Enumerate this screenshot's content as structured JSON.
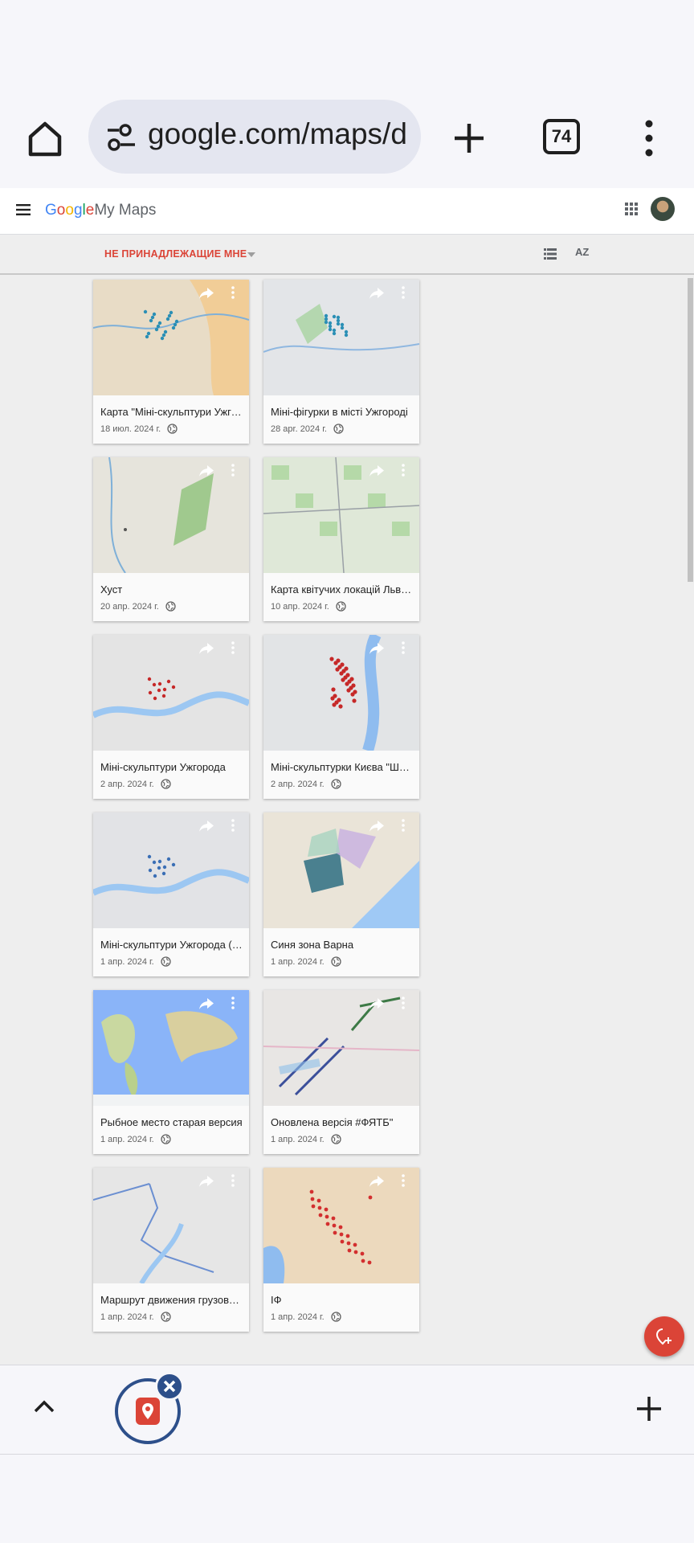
{
  "browser": {
    "url": "google.com/maps/d",
    "tab_count": "74",
    "icons": [
      "home-icon",
      "tune-icon",
      "new-tab-icon",
      "more-vert-icon"
    ]
  },
  "app": {
    "logo_google": "Google",
    "logo_product": "My Maps",
    "logo_colors": [
      "#4285f4",
      "#db4437",
      "#f4b400",
      "#4285f4",
      "#0f9d58",
      "#db4437"
    ]
  },
  "filter": {
    "label": "НЕ ПРИНАДЛЕЖАЩИЕ МНЕ",
    "sort_label": "AZ"
  },
  "maps": [
    {
      "title": "Карта \"Міні-скульптури Ужгорода\"",
      "date": "18 июл. 2024 г.",
      "theme": "orange-city"
    },
    {
      "title": "Міні-фігурки в місті Ужгороді",
      "date": "28 apr. 2024 г.",
      "theme": "grey-city"
    },
    {
      "title": "Хуст",
      "date": "20 апр. 2024 г.",
      "theme": "terrain"
    },
    {
      "title": "Карта квітучих локацій Львова",
      "date": "10 апр. 2024 г.",
      "theme": "green-city"
    },
    {
      "title": "Міні-скульптури Ужгорода",
      "date": "2 апр. 2024 г.",
      "theme": "river"
    },
    {
      "title": "Міні-скульптурки Києва \"Шукай\"",
      "date": "2 апр. 2024 г.",
      "theme": "kyiv"
    },
    {
      "title": "Міні-скульптури Ужгорода (стара)",
      "date": "1 апр. 2024 г.",
      "theme": "river-blue"
    },
    {
      "title": "Синя зона Варна",
      "date": "1 апр. 2024 г.",
      "theme": "varna"
    },
    {
      "title": "Рыбное место старая версия",
      "date": "1 апр. 2024 г.",
      "theme": "world"
    },
    {
      "title": "Оновлена версія #ФЯТБ\"",
      "date": "1 апр. 2024 г.",
      "theme": "lines"
    },
    {
      "title": "Маршрут движения грузового",
      "date": "1 апр. 2024 г.",
      "theme": "route"
    },
    {
      "title": "ІФ",
      "date": "1 апр. 2024 г.",
      "theme": "if"
    }
  ]
}
